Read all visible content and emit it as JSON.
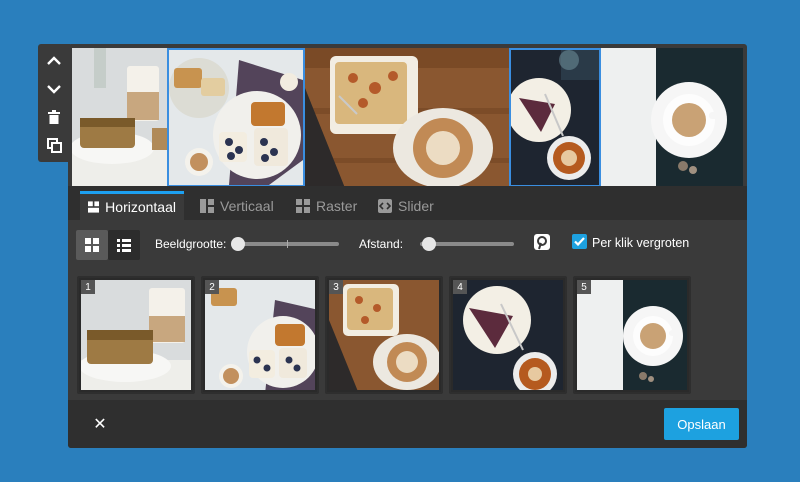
{
  "colors": {
    "background": "#2a7fbd",
    "panel": "#3a3a3a",
    "accent": "#1da1f2",
    "save_button": "#1da1e0",
    "selection_border": "#3a8ee0"
  },
  "toolbar": {
    "icons": [
      "chevron-up-icon",
      "chevron-down-icon",
      "trash-icon",
      "copy-icon"
    ]
  },
  "tabs": [
    {
      "label": "Horizontaal",
      "icon": "grid-icon",
      "active": true
    },
    {
      "label": "Verticaal",
      "icon": "vertical-icon",
      "active": false
    },
    {
      "label": "Raster",
      "icon": "grid-icon",
      "active": false
    },
    {
      "label": "Slider",
      "icon": "slider-icon",
      "active": false
    }
  ],
  "options": {
    "image_size_label": "Beeldgrootte:",
    "spacing_label": "Afstand:",
    "zoom_on_click_label": "Per klik vergroten",
    "zoom_on_click_checked": true,
    "pinterest_icon": "pinterest-icon",
    "view_grid_icon": "grid-view-icon",
    "view_list_icon": "list-view-icon"
  },
  "thumbnails": [
    {
      "number": "1"
    },
    {
      "number": "2"
    },
    {
      "number": "3"
    },
    {
      "number": "4"
    },
    {
      "number": "5"
    }
  ],
  "footer": {
    "close_label": "✕",
    "save_label": "Opslaan"
  }
}
